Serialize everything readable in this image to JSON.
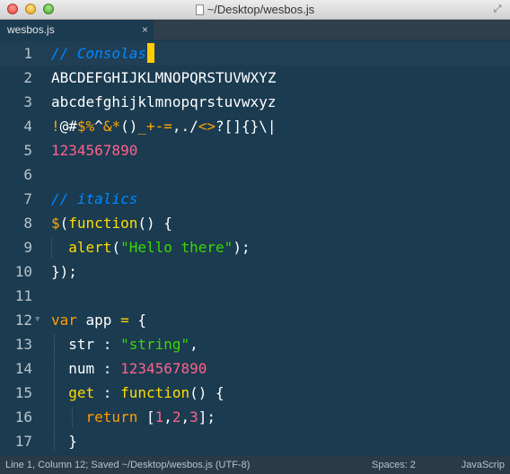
{
  "window": {
    "title": "~/Desktop/wesbos.js"
  },
  "tabs": [
    {
      "label": "wesbos.js",
      "close": "×"
    }
  ],
  "colors": {
    "background": "#1b3b50",
    "comment": "#0088ff",
    "string": "#3ad900",
    "number": "#ff628c",
    "keyword": "#ff9d00",
    "function": "#ffdd00",
    "cursor": "#ffcc00"
  },
  "editor": {
    "lines": [
      {
        "number": "1",
        "tokens": [
          {
            "text": "// Consolas",
            "cls": "c-comment"
          }
        ]
      },
      {
        "number": "2",
        "tokens": [
          {
            "text": "ABCDEFGHIJKLMNOPQRSTUVWXYZ",
            "cls": ""
          }
        ]
      },
      {
        "number": "3",
        "tokens": [
          {
            "text": "abcdefghijklmnopqrstuvwxyz",
            "cls": ""
          }
        ]
      },
      {
        "number": "4",
        "tokens": [
          {
            "text": "!",
            "cls": "c-sym"
          },
          {
            "text": "@#",
            "cls": ""
          },
          {
            "text": "$%",
            "cls": "c-sym"
          },
          {
            "text": "^",
            "cls": ""
          },
          {
            "text": "&*",
            "cls": "c-sym"
          },
          {
            "text": "()",
            "cls": ""
          },
          {
            "text": "_+-=",
            "cls": "c-sym"
          },
          {
            "text": ",./",
            "cls": ""
          },
          {
            "text": "<>",
            "cls": "c-sym"
          },
          {
            "text": "?[]{}\\|",
            "cls": ""
          }
        ]
      },
      {
        "number": "5",
        "tokens": [
          {
            "text": "1234567890",
            "cls": "c-num"
          }
        ]
      },
      {
        "number": "6",
        "tokens": []
      },
      {
        "number": "7",
        "tokens": [
          {
            "text": "// italics",
            "cls": "c-comment"
          }
        ]
      },
      {
        "number": "8",
        "tokens": [
          {
            "text": "$",
            "cls": "c-sym"
          },
          {
            "text": "(",
            "cls": ""
          },
          {
            "text": "function",
            "cls": "c-fn"
          },
          {
            "text": "() {",
            "cls": ""
          }
        ]
      },
      {
        "number": "9",
        "tokens": [
          {
            "text": "  ",
            "cls": ""
          },
          {
            "text": "alert",
            "cls": "c-fn"
          },
          {
            "text": "(",
            "cls": ""
          },
          {
            "text": "\"Hello there\"",
            "cls": "c-str"
          },
          {
            "text": ");",
            "cls": ""
          }
        ]
      },
      {
        "number": "10",
        "tokens": [
          {
            "text": "});",
            "cls": ""
          }
        ]
      },
      {
        "number": "11",
        "tokens": []
      },
      {
        "number": "12",
        "fold": "▼",
        "tokens": [
          {
            "text": "var",
            "cls": "c-kw"
          },
          {
            "text": " app ",
            "cls": ""
          },
          {
            "text": "=",
            "cls": "c-op"
          },
          {
            "text": " {",
            "cls": ""
          }
        ]
      },
      {
        "number": "13",
        "tokens": [
          {
            "text": "  str : ",
            "cls": ""
          },
          {
            "text": "\"string\"",
            "cls": "c-str"
          },
          {
            "text": ",",
            "cls": ""
          }
        ]
      },
      {
        "number": "14",
        "tokens": [
          {
            "text": "  num : ",
            "cls": ""
          },
          {
            "text": "1234567890",
            "cls": "c-num"
          }
        ]
      },
      {
        "number": "15",
        "tokens": [
          {
            "text": "  ",
            "cls": ""
          },
          {
            "text": "get",
            "cls": "c-fn"
          },
          {
            "text": " : ",
            "cls": ""
          },
          {
            "text": "function",
            "cls": "c-fn"
          },
          {
            "text": "() {",
            "cls": ""
          }
        ]
      },
      {
        "number": "16",
        "tokens": [
          {
            "text": "    ",
            "cls": ""
          },
          {
            "text": "return",
            "cls": "c-kw"
          },
          {
            "text": " [",
            "cls": ""
          },
          {
            "text": "1",
            "cls": "c-num"
          },
          {
            "text": ",",
            "cls": ""
          },
          {
            "text": "2",
            "cls": "c-num"
          },
          {
            "text": ",",
            "cls": ""
          },
          {
            "text": "3",
            "cls": "c-num"
          },
          {
            "text": "];",
            "cls": ""
          }
        ]
      },
      {
        "number": "17",
        "tokens": [
          {
            "text": "  }",
            "cls": ""
          }
        ]
      }
    ]
  },
  "statusbar": {
    "position": "Line 1, Column 12; Saved ~/Desktop/wesbos.js (UTF-8)",
    "spaces": "Spaces: 2",
    "syntax": "JavaScrip"
  }
}
